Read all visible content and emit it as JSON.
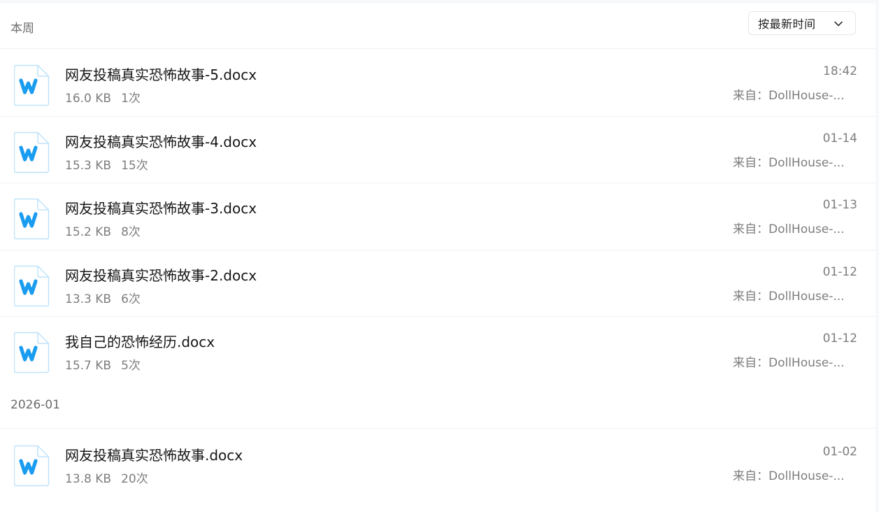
{
  "sections": [
    {
      "label": "本周"
    },
    {
      "label": "2026-01"
    }
  ],
  "sort": {
    "label": "按最新时间"
  },
  "files": [
    {
      "name": "网友投稿真实恐怖故事-5.docx",
      "size": "16.0 KB",
      "views": "1次",
      "time": "18:42",
      "source": "来自：DollHouse-..."
    },
    {
      "name": "网友投稿真实恐怖故事-4.docx",
      "size": "15.3 KB",
      "views": "15次",
      "time": "01-14",
      "source": "来自：DollHouse-..."
    },
    {
      "name": "网友投稿真实恐怖故事-3.docx",
      "size": "15.2 KB",
      "views": "8次",
      "time": "01-13",
      "source": "来自：DollHouse-..."
    },
    {
      "name": "网友投稿真实恐怖故事-2.docx",
      "size": "13.3 KB",
      "views": "6次",
      "time": "01-12",
      "source": "来自：DollHouse-..."
    },
    {
      "name": "我自己的恐怖经历.docx",
      "size": "15.7 KB",
      "views": "5次",
      "time": "01-12",
      "source": "来自：DollHouse-..."
    },
    {
      "name": "网友投稿真实恐怖故事.docx",
      "size": "13.8 KB",
      "views": "20次",
      "time": "01-02",
      "source": "来自：DollHouse-..."
    }
  ],
  "icons": {
    "file": "word-doc-icon",
    "dropdown": "chevron-down-icon"
  },
  "colors": {
    "word_icon_blue": "#1a9cf0",
    "icon_border": "#bfe3fb"
  }
}
